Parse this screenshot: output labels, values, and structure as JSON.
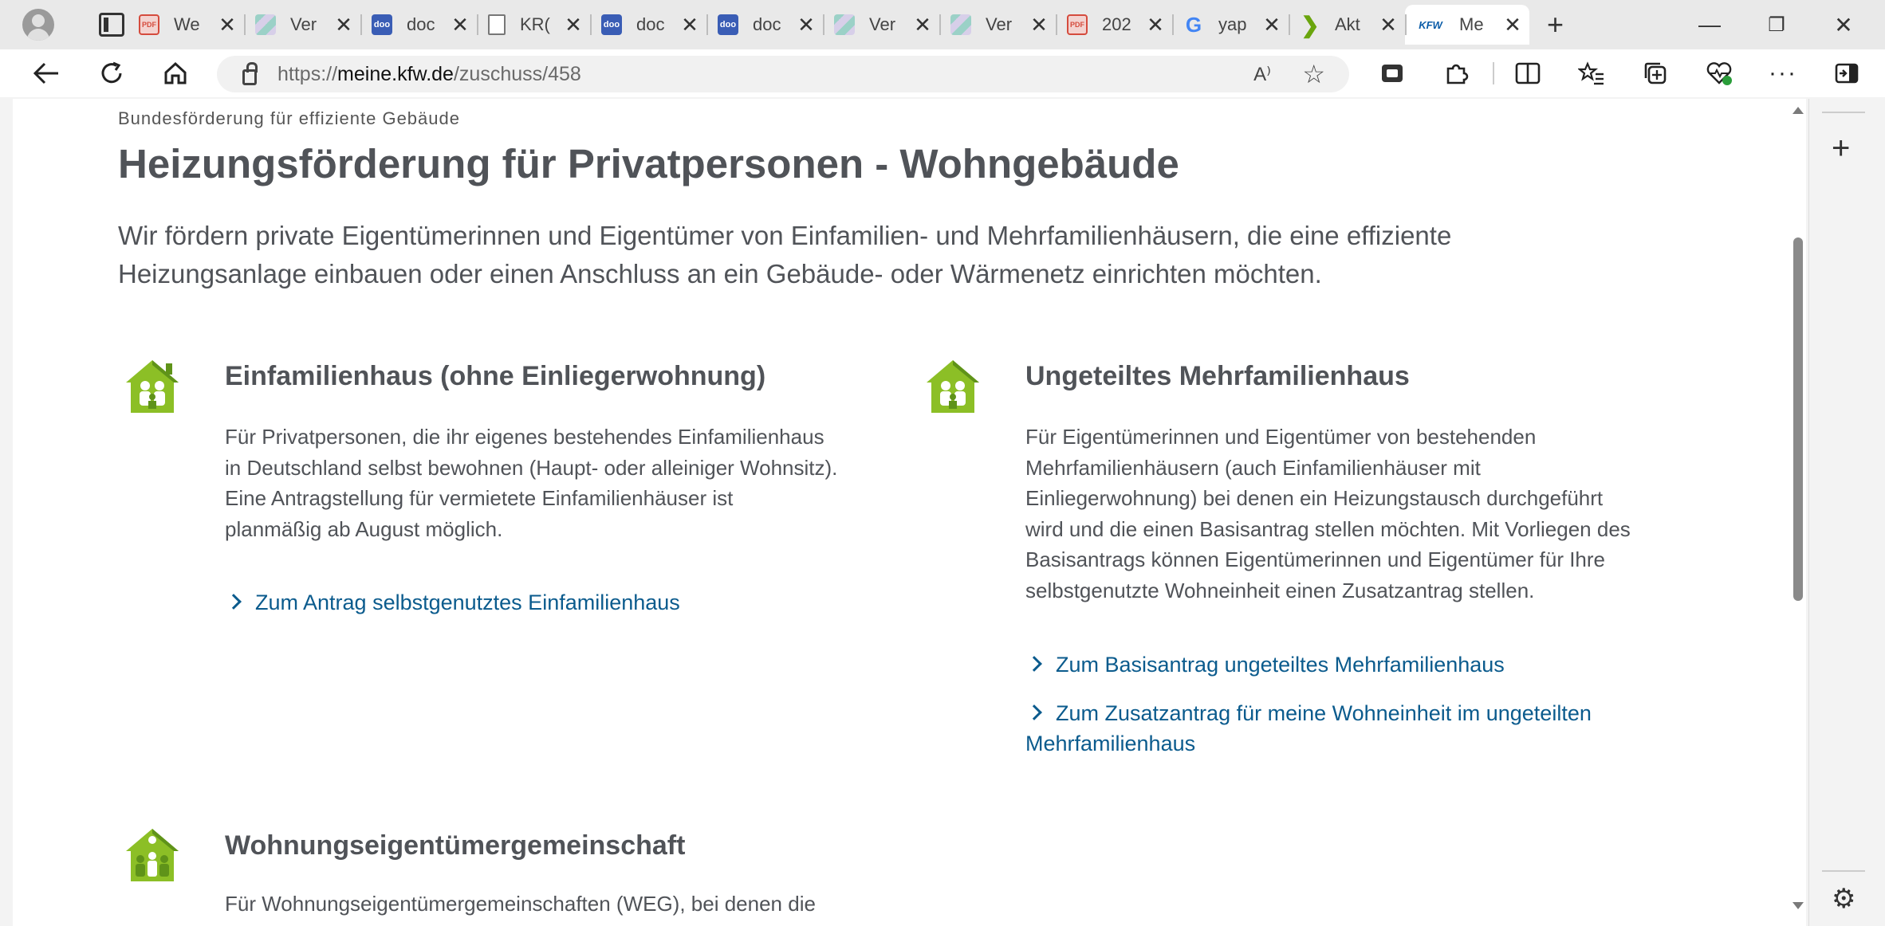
{
  "browser": {
    "tabs": [
      {
        "favicon": "pdf-icon",
        "title": "We"
      },
      {
        "favicon": "pattern-icon",
        "title": "Ver"
      },
      {
        "favicon": "doo-icon",
        "title": "doc"
      },
      {
        "favicon": "document-icon",
        "title": "KR("
      },
      {
        "favicon": "doo-icon",
        "title": "doc"
      },
      {
        "favicon": "doo-icon",
        "title": "doc"
      },
      {
        "favicon": "pattern-icon",
        "title": "Ver"
      },
      {
        "favicon": "pattern-icon",
        "title": "Ver"
      },
      {
        "favicon": "pdf-icon",
        "title": "202"
      },
      {
        "favicon": "google-icon",
        "title": "yap"
      },
      {
        "favicon": "arrow-icon",
        "title": "Akt"
      },
      {
        "favicon": "kfw-icon",
        "title": "Me"
      }
    ],
    "favicon_text": {
      "pdf": "PDF",
      "doo": "doo",
      "google": "G",
      "arrow": "❯",
      "kfw": "KFW"
    },
    "address": {
      "prefix": "https://",
      "domain": "meine.kfw.de",
      "path": "/zuschuss/458"
    },
    "read_aloud": "A⁾",
    "icons": {
      "close": "✕",
      "new_tab": "+",
      "minimize": "—",
      "restore": "❐",
      "more": "···"
    }
  },
  "page": {
    "eyebrow": "Bundesförderung für effiziente Gebäude",
    "title": "Heizungsförderung für Privatpersonen - Wohngebäude",
    "intro_line1": "Wir fördern private Eigentümerinnen und Eigentümer von Einfamilien- und Mehrfamilienhäusern, die eine effiziente",
    "intro_line2": "Heizungsanlage einbauen oder einen Anschluss an ein Gebäude- oder Wärmenetz einrichten möchten.",
    "cards": [
      {
        "title": "Einfamilienhaus (ohne Einliegerwohnung)",
        "lines": [
          "Für Privatpersonen, die ihr eigenes bestehendes Einfamilienhaus",
          "in Deutschland selbst bewohnen (Haupt- oder alleiniger Wohnsitz).",
          "Eine Antragstellung für vermietete Einfamilienhäuser ist",
          "planmäßig ab August möglich."
        ],
        "links": [
          "Zum Antrag selbstgenutztes Einfamilienhaus"
        ]
      },
      {
        "title": "Ungeteiltes Mehrfamilienhaus",
        "lines": [
          "Für Eigentümerinnen und Eigentümer von bestehenden",
          "Mehrfamilienhäusern (auch Einfamilienhäuser mit",
          "Einliegerwohnung) bei denen ein Heizungstausch durchgeführt",
          "wird und die einen Basisantrag stellen möchten. Mit Vorliegen des",
          "Basisantrags können Eigentümerinnen und Eigentümer für Ihre",
          "selbstgenutzte Wohneinheit einen Zusatzantrag stellen."
        ],
        "links": [
          "Zum Basisantrag ungeteiltes Mehrfamilienhaus",
          "Zum Zusatzantrag für meine Wohneinheit im ungeteilten",
          "Mehrfamilienhaus"
        ]
      },
      {
        "title": "Wohnungseigentümergemeinschaft",
        "lines": [
          "Für Wohnungseigentümergemeinschaften (WEG), bei denen die"
        ]
      }
    ],
    "colors": {
      "text": "#505358",
      "link": "#0b5b8d",
      "icon_green_light": "#8cbf26",
      "icon_green_dark": "#5f9319"
    }
  }
}
